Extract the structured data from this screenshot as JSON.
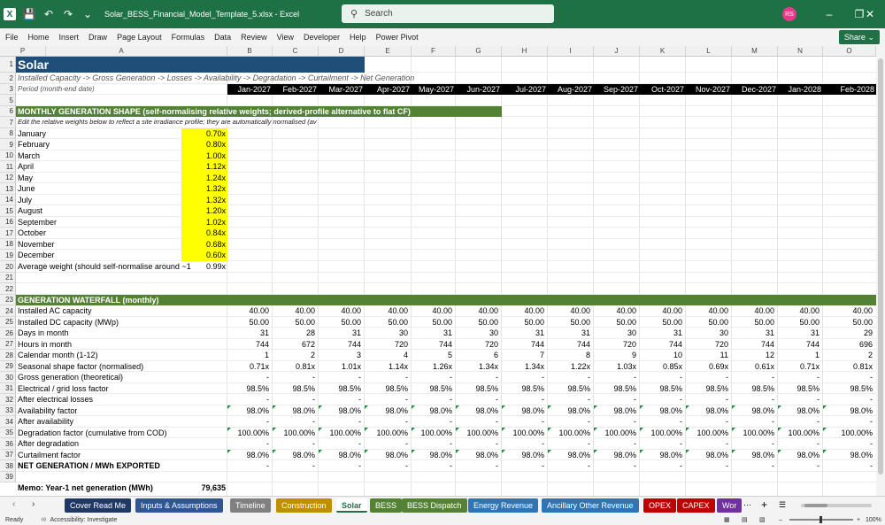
{
  "window": {
    "doc_title": "Solar_BESS_Financial_Model_Template_5.xlsx  -  Excel",
    "search_placeholder": "Search",
    "avatar": "RS"
  },
  "menu": [
    "File",
    "Home",
    "Insert",
    "Draw",
    "Page Layout",
    "Formulas",
    "Data",
    "Review",
    "View",
    "Developer",
    "Help",
    "Power Pivot"
  ],
  "share_label": "Share",
  "columns": [
    "A",
    "B",
    "C",
    "D",
    "E",
    "F",
    "G",
    "H",
    "I",
    "J",
    "K",
    "L",
    "M",
    "N",
    "O",
    "P"
  ],
  "rows": [
    "1",
    "2",
    "3",
    "5",
    "6",
    "7",
    "8",
    "9",
    "10",
    "11",
    "12",
    "13",
    "14",
    "15",
    "16",
    "17",
    "18",
    "19",
    "20",
    "21",
    "22",
    "23",
    "24",
    "25",
    "26",
    "27",
    "28",
    "29",
    "30",
    "31",
    "32",
    "33",
    "34",
    "35",
    "36",
    "37",
    "38",
    "39"
  ],
  "sheet": {
    "title": "Solar",
    "flow": "Installed Capacity -> Gross Generation -> Losses -> Availability -> Degradation -> Curtailment -> Net Generation",
    "period_label": "Period (month-end date)",
    "periods": [
      "Jan-2027",
      "Feb-2027",
      "Mar-2027",
      "Apr-2027",
      "May-2027",
      "Jun-2027",
      "Jul-2027",
      "Aug-2027",
      "Sep-2027",
      "Oct-2027",
      "Nov-2027",
      "Dec-2027",
      "Jan-2028",
      "Feb-2028"
    ],
    "shape_header": "MONTHLY GENERATION SHAPE (self-normalising relative weights; derived-profile alternative to flat CF)",
    "shape_note": "Edit the relative weights below to reflect a site irradiance profile; they are automatically normalised (av",
    "months": [
      {
        "name": "January",
        "weight": "0.70x"
      },
      {
        "name": "February",
        "weight": "0.80x"
      },
      {
        "name": "March",
        "weight": "1.00x"
      },
      {
        "name": "April",
        "weight": "1.12x"
      },
      {
        "name": "May",
        "weight": "1.24x"
      },
      {
        "name": "June",
        "weight": "1.32x"
      },
      {
        "name": "July",
        "weight": "1.32x"
      },
      {
        "name": "August",
        "weight": "1.20x"
      },
      {
        "name": "September",
        "weight": "1.02x"
      },
      {
        "name": "October",
        "weight": "0.84x"
      },
      {
        "name": "November",
        "weight": "0.68x"
      },
      {
        "name": "December",
        "weight": "0.60x"
      }
    ],
    "avg_label": "Average weight (should self-normalise around ~1",
    "avg_value": "0.99x",
    "waterfall_header": "GENERATION WATERFALL (monthly)",
    "waterfall": [
      {
        "label": "Installed AC capacity",
        "values": [
          "40.00",
          "40.00",
          "40.00",
          "40.00",
          "40.00",
          "40.00",
          "40.00",
          "40.00",
          "40.00",
          "40.00",
          "40.00",
          "40.00",
          "40.00",
          "40.00"
        ]
      },
      {
        "label": "Installed DC capacity (MWp)",
        "values": [
          "50.00",
          "50.00",
          "50.00",
          "50.00",
          "50.00",
          "50.00",
          "50.00",
          "50.00",
          "50.00",
          "50.00",
          "50.00",
          "50.00",
          "50.00",
          "50.00"
        ]
      },
      {
        "label": "Days in month",
        "values": [
          "31",
          "28",
          "31",
          "30",
          "31",
          "30",
          "31",
          "31",
          "30",
          "31",
          "30",
          "31",
          "31",
          "29"
        ]
      },
      {
        "label": "Hours in month",
        "values": [
          "744",
          "672",
          "744",
          "720",
          "744",
          "720",
          "744",
          "744",
          "720",
          "744",
          "720",
          "744",
          "744",
          "696"
        ]
      },
      {
        "label": "Calendar month (1-12)",
        "values": [
          "1",
          "2",
          "3",
          "4",
          "5",
          "6",
          "7",
          "8",
          "9",
          "10",
          "11",
          "12",
          "1",
          "2"
        ]
      },
      {
        "label": "Seasonal shape factor (normalised)",
        "values": [
          "0.71x",
          "0.81x",
          "1.01x",
          "1.14x",
          "1.26x",
          "1.34x",
          "1.34x",
          "1.22x",
          "1.03x",
          "0.85x",
          "0.69x",
          "0.61x",
          "0.71x",
          "0.81x"
        ]
      },
      {
        "label": "Gross generation (theoretical)",
        "values": [
          "-",
          "-",
          "-",
          "-",
          "-",
          "-",
          "-",
          "-",
          "-",
          "-",
          "-",
          "-",
          "-",
          "-"
        ]
      },
      {
        "label": "Electrical / grid loss factor",
        "values": [
          "98.5%",
          "98.5%",
          "98.5%",
          "98.5%",
          "98.5%",
          "98.5%",
          "98.5%",
          "98.5%",
          "98.5%",
          "98.5%",
          "98.5%",
          "98.5%",
          "98.5%",
          "98.5%"
        ]
      },
      {
        "label": "After electrical losses",
        "values": [
          "-",
          "-",
          "-",
          "-",
          "-",
          "-",
          "-",
          "-",
          "-",
          "-",
          "-",
          "-",
          "-",
          "-"
        ]
      },
      {
        "label": "Availability factor",
        "values": [
          "98.0%",
          "98.0%",
          "98.0%",
          "98.0%",
          "98.0%",
          "98.0%",
          "98.0%",
          "98.0%",
          "98.0%",
          "98.0%",
          "98.0%",
          "98.0%",
          "98.0%",
          "98.0%"
        ]
      },
      {
        "label": "After availability",
        "values": [
          "-",
          "-",
          "-",
          "-",
          "-",
          "-",
          "-",
          "-",
          "-",
          "-",
          "-",
          "-",
          "-",
          "-"
        ]
      },
      {
        "label": "Degradation factor (cumulative from COD)",
        "values": [
          "100.00%",
          "100.00%",
          "100.00%",
          "100.00%",
          "100.00%",
          "100.00%",
          "100.00%",
          "100.00%",
          "100.00%",
          "100.00%",
          "100.00%",
          "100.00%",
          "100.00%",
          "100.00%"
        ]
      },
      {
        "label": "After degradation",
        "values": [
          "-",
          "-",
          "-",
          "-",
          "-",
          "-",
          "-",
          "-",
          "-",
          "-",
          "-",
          "-",
          "-",
          "-"
        ]
      },
      {
        "label": "Curtailment factor",
        "values": [
          "98.0%",
          "98.0%",
          "98.0%",
          "98.0%",
          "98.0%",
          "98.0%",
          "98.0%",
          "98.0%",
          "98.0%",
          "98.0%",
          "98.0%",
          "98.0%",
          "98.0%",
          "98.0%"
        ]
      },
      {
        "label": "NET GENERATION / MWh EXPORTED",
        "values": [
          "-",
          "-",
          "-",
          "-",
          "-",
          "-",
          "-",
          "-",
          "-",
          "-",
          "-",
          "-",
          "-",
          "-"
        ]
      }
    ],
    "memo_label": "Memo: Year-1 net generation (MWh)",
    "memo_value": "79,635"
  },
  "tabs": [
    {
      "label": "Cover Read Me",
      "color": "#1f3864"
    },
    {
      "label": "Inputs & Assumptions",
      "color": "#2f5597"
    },
    {
      "label": "Timeline",
      "color": "#808080"
    },
    {
      "label": "Construction",
      "color": "#bf8f00"
    },
    {
      "label": "Solar",
      "color": "#ffffff"
    },
    {
      "label": "BESS",
      "color": "#548235"
    },
    {
      "label": "BESS Dispatch",
      "color": "#548235"
    },
    {
      "label": "Energy Revenue",
      "color": "#2e75b6"
    },
    {
      "label": "Ancillary Other Revenue",
      "color": "#2e75b6"
    },
    {
      "label": "OPEX",
      "color": "#c00000"
    },
    {
      "label": "CAPEX",
      "color": "#c00000"
    },
    {
      "label": "Wor",
      "color": "#7030a0"
    }
  ],
  "status": {
    "ready": "Ready",
    "accessibility": "Accessibility: Investigate",
    "zoom": "100%"
  }
}
